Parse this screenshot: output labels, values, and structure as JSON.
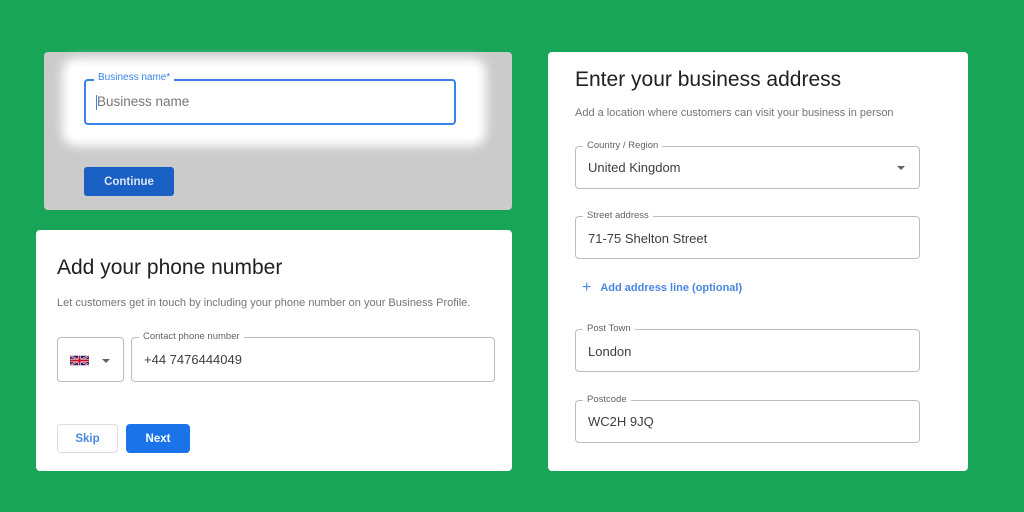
{
  "business_card": {
    "field_label": "Business name*",
    "field_placeholder": "Business name",
    "continue_label": "Continue"
  },
  "phone_card": {
    "title": "Add your phone number",
    "subtitle": "Let customers get in touch by including your phone number on your Business Profile.",
    "country_flag": "uk-flag-icon",
    "phone_label": "Contact phone number",
    "phone_value": "+44 7476444049",
    "skip_label": "Skip",
    "next_label": "Next"
  },
  "address_card": {
    "title": "Enter your business address",
    "subtitle": "Add a location where customers can visit your business in person",
    "country": {
      "label": "Country / Region",
      "value": "United Kingdom"
    },
    "street": {
      "label": "Street address",
      "value": "71-75 Shelton Street"
    },
    "add_line_label": "Add address line (optional)",
    "town": {
      "label": "Post Town",
      "value": "London"
    },
    "postcode": {
      "label": "Postcode",
      "value": "WC2H 9JQ"
    }
  },
  "colors": {
    "background": "#18a558",
    "primary": "#1a73e8",
    "focus": "#3b82e6"
  }
}
